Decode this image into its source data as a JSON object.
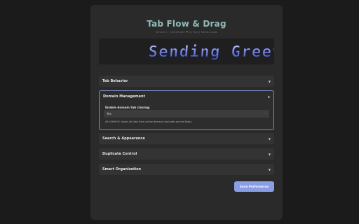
{
  "header": {
    "title": "Tab Flow & Drag",
    "subtitle_pre": "Version 1 · Crafted with",
    "subtitle_post": "by Vlad | Tomas Lasolo"
  },
  "banner": {
    "text": "Sending Greetings"
  },
  "sections": [
    {
      "label": "Tab Behavior",
      "icon": "chevron-down-icon",
      "expanded": false
    },
    {
      "label": "Domain Management",
      "icon": "chevron-up-icon",
      "expanded": true,
      "field_label": "Enable domain tab closing:",
      "select_value": "Yes",
      "hint": "Alt+Shift+X closes all tabs from active domain (excludes pinned tabs)."
    },
    {
      "label": "Search & Appearance",
      "icon": "chevron-down-icon",
      "expanded": false
    },
    {
      "label": "Duplicate Control",
      "icon": "chevron-down-icon",
      "expanded": false
    },
    {
      "label": "Smart Organization",
      "icon": "chevron-down-icon",
      "expanded": false
    }
  ],
  "save_label": "Save Preferences",
  "colors": {
    "accent": "#8a9ee6",
    "title": "#8fbcb4",
    "active_border": "#7c8cc4",
    "background": "#1b1b1b"
  }
}
